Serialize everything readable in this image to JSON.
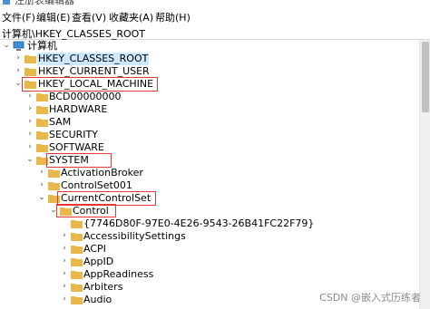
{
  "window": {
    "title": "注册表编辑器"
  },
  "menu": [
    "文件(F)",
    "编辑(E)",
    "查看(V)",
    "收藏夹(A)",
    "帮助(H)"
  ],
  "address": "计算机\\HKEY_CLASSES_ROOT",
  "tree": [
    {
      "id": "computer",
      "label": "计算机",
      "expand": "open",
      "icon": "computer-icon"
    },
    {
      "id": "hkcr",
      "label": "HKEY_CLASSES_ROOT",
      "expand": "closed",
      "selected": true
    },
    {
      "id": "hkcu",
      "label": "HKEY_CURRENT_USER",
      "expand": "closed"
    },
    {
      "id": "hklm",
      "label": "HKEY_LOCAL_MACHINE",
      "expand": "open",
      "highlighted": true
    },
    {
      "id": "bcd",
      "label": "BCD00000000",
      "expand": "closed"
    },
    {
      "id": "hardware",
      "label": "HARDWARE",
      "expand": "closed"
    },
    {
      "id": "sam",
      "label": "SAM",
      "expand": "closed"
    },
    {
      "id": "security",
      "label": "SECURITY",
      "expand": "closed"
    },
    {
      "id": "software",
      "label": "SOFTWARE",
      "expand": "closed"
    },
    {
      "id": "system",
      "label": "SYSTEM",
      "expand": "open",
      "highlighted": true
    },
    {
      "id": "activationbroker",
      "label": "ActivationBroker",
      "expand": "closed"
    },
    {
      "id": "controlset001",
      "label": "ControlSet001",
      "expand": "closed"
    },
    {
      "id": "currentcontrolset",
      "label": "CurrentControlSet",
      "expand": "open",
      "highlighted": true
    },
    {
      "id": "control",
      "label": "Control",
      "expand": "open",
      "highlighted": true
    },
    {
      "id": "guid",
      "label": "{7746D80F-97E0-4E26-9543-26B41FC22F79}",
      "expand": "none"
    },
    {
      "id": "accessibility",
      "label": "AccessibilitySettings",
      "expand": "closed"
    },
    {
      "id": "acpi",
      "label": "ACPI",
      "expand": "closed"
    },
    {
      "id": "appid",
      "label": "AppID",
      "expand": "closed"
    },
    {
      "id": "appreadiness",
      "label": "AppReadiness",
      "expand": "closed"
    },
    {
      "id": "arbiters",
      "label": "Arbiters",
      "expand": "closed"
    },
    {
      "id": "audio",
      "label": "Audio",
      "expand": "closed"
    }
  ],
  "watermark": "CSDN @嵌入式历练者",
  "colors": {
    "folder": "#e8b94a",
    "selection": "#cde8ff",
    "highlight_box": "#e53935"
  }
}
